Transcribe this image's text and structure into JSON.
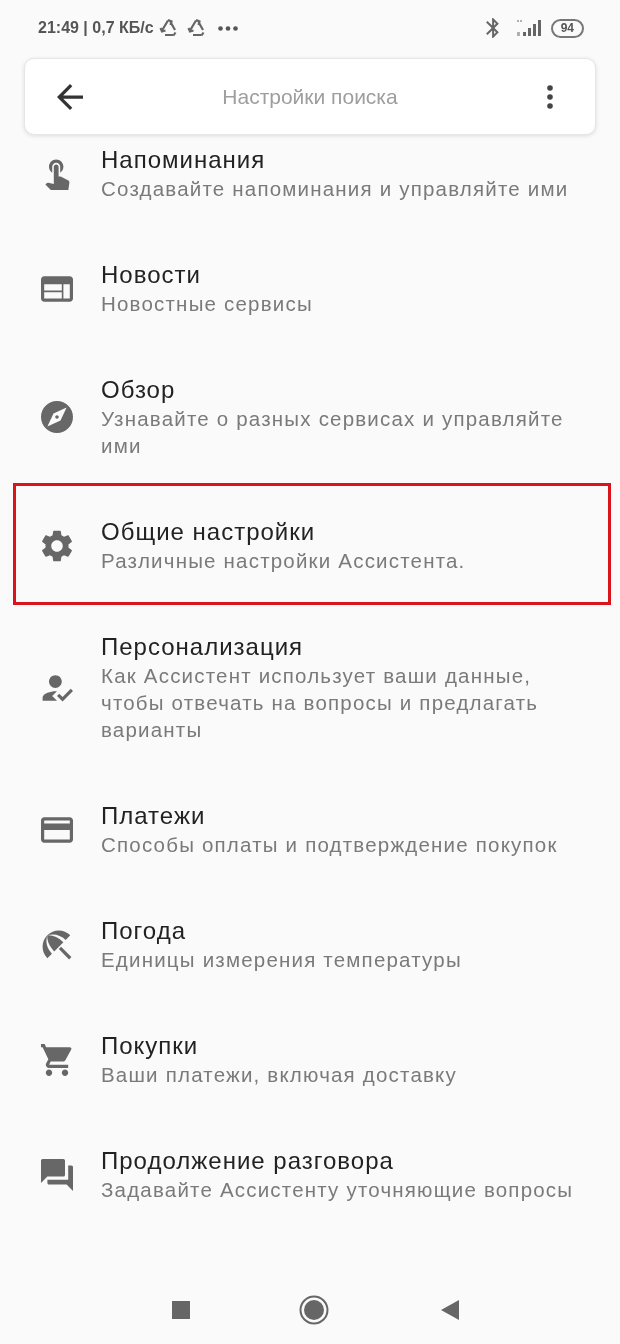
{
  "status_bar": {
    "time_and_speed": "21:49 | 0,7 КБ/с",
    "battery": "94"
  },
  "toolbar": {
    "title": "Настройки поиска"
  },
  "items": [
    {
      "title": "Напоминания",
      "subtitle": "Создавайте напоминания и управляйте ими",
      "highlighted": false
    },
    {
      "title": "Новости",
      "subtitle": "Новостные сервисы",
      "highlighted": false
    },
    {
      "title": "Обзор",
      "subtitle": "Узнавайте о разных сервисах и управляйте ими",
      "highlighted": false
    },
    {
      "title": "Общие настройки",
      "subtitle": "Различные настройки Ассистента.",
      "highlighted": true
    },
    {
      "title": "Персонализация",
      "subtitle": "Как Ассистент использует ваши данные, чтобы отвечать на вопросы и предлагать варианты",
      "highlighted": false
    },
    {
      "title": "Платежи",
      "subtitle": "Способы оплаты и подтверждение покупок",
      "highlighted": false
    },
    {
      "title": "Погода",
      "subtitle": "Единицы измерения температуры",
      "highlighted": false
    },
    {
      "title": "Покупки",
      "subtitle": "Ваши платежи, включая доставку",
      "highlighted": false
    },
    {
      "title": "Продолжение разговора",
      "subtitle": "Задавайте Ассистенту уточняющие вопросы",
      "highlighted": false
    }
  ]
}
